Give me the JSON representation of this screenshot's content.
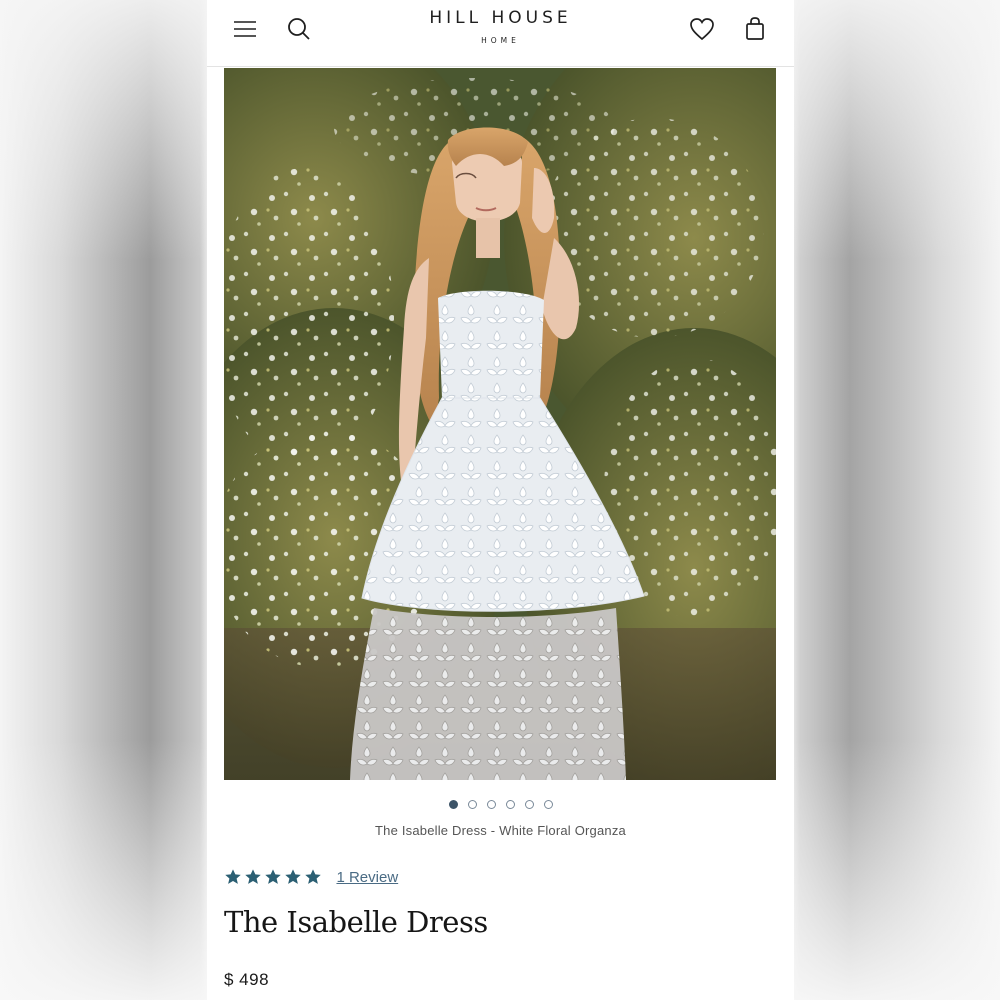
{
  "header": {
    "brand": "HILL HOUSE",
    "brand_sub": "HOME",
    "icons": {
      "menu": "hamburger-menu-icon",
      "search": "search-icon",
      "wishlist": "heart-icon",
      "cart": "shopping-bag-icon"
    }
  },
  "gallery": {
    "slide_count": 6,
    "active_slide": 1,
    "caption": "The Isabelle Dress - White Floral Organza"
  },
  "product": {
    "rating_stars": 5,
    "review_link": "1 Review",
    "title": "The Isabelle Dress",
    "price": "$ 498"
  },
  "colors": {
    "star": "#2b5f73",
    "dot_active": "#3d5468",
    "link": "#4a6b84"
  }
}
